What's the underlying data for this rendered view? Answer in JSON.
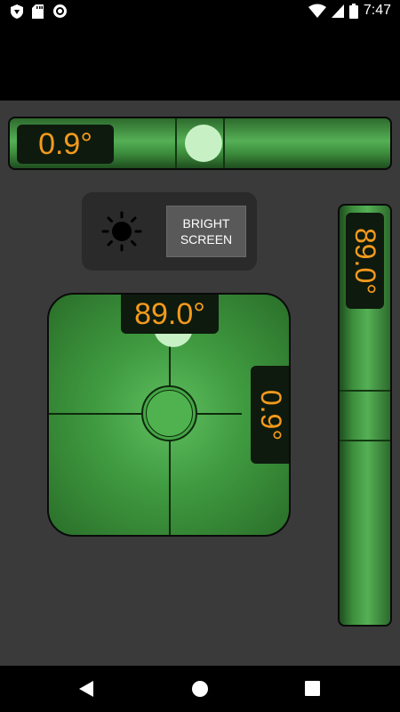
{
  "status_bar": {
    "time": "7:47",
    "icons": [
      "shield-icon",
      "sd-card-icon",
      "circle-icon",
      "wifi-icon",
      "signal-icon",
      "battery-icon"
    ]
  },
  "horizontal_level": {
    "reading": "0.9°",
    "bubble_offset": 0.52
  },
  "vertical_level": {
    "reading": "89.0°",
    "bubble_offset": 0.1
  },
  "surface_level": {
    "top_reading": "89.0°",
    "side_reading": "0.9°"
  },
  "brightness": {
    "icon": "sun-icon",
    "button_label": "BRIGHT SCREEN"
  },
  "nav": {
    "icons": [
      "back-icon",
      "home-icon",
      "recents-icon"
    ]
  },
  "colors": {
    "readout_text": "#f39a1c",
    "bubble": "#c7f1c4",
    "level_green": "#3c8c3c"
  }
}
